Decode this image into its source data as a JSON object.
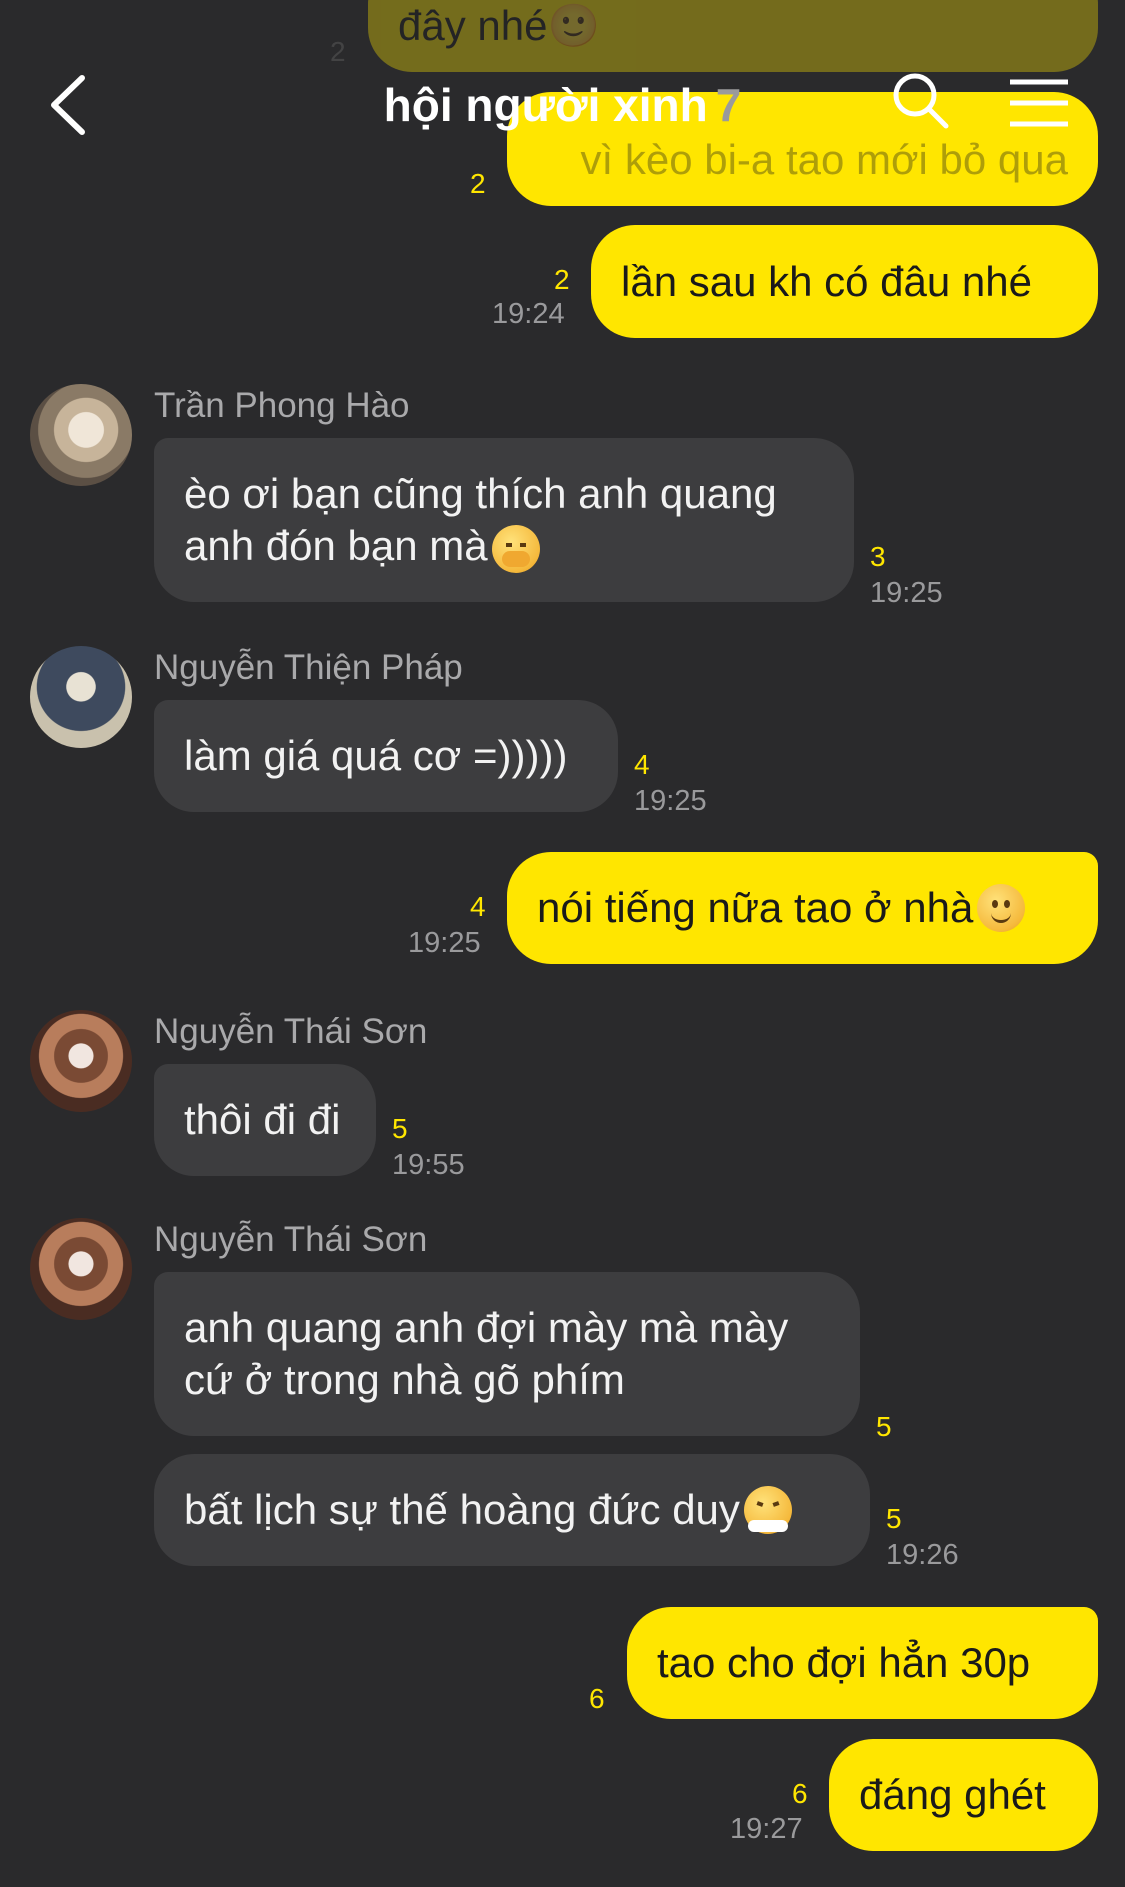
{
  "header": {
    "title": "hội người xinh",
    "member_count": "7"
  },
  "colors": {
    "background": "#2a2a2c",
    "my_bubble": "#ffe600",
    "their_bubble": "#3d3d3f",
    "unread_count": "#ffe600"
  },
  "messages": {
    "m0": {
      "text": "đây nhé🙂",
      "unread": "2"
    },
    "m1": {
      "text": "vì kèo bi-a tao mới bỏ qua",
      "unread": "2"
    },
    "m2": {
      "text": "lần sau kh có đâu nhé",
      "unread": "2",
      "time": "19:24"
    },
    "m3": {
      "sender": "Trần Phong Hào",
      "line1": "èo ơi bạn cũng thích anh quang",
      "line2": "anh đón bạn mà",
      "emoji": "hand-over-mouth-emoji",
      "unread": "3",
      "time": "19:25"
    },
    "m4": {
      "sender": "Nguyễn Thiện Pháp",
      "text": "làm giá quá cơ =)))))",
      "unread": "4",
      "time": "19:25"
    },
    "m5": {
      "text": "nói tiếng nữa tao ở nhà",
      "emoji": "slight-smile-emoji",
      "unread": "4",
      "time": "19:25"
    },
    "m6": {
      "sender": "Nguyễn Thái Sơn",
      "text": "thôi đi đi",
      "unread": "5",
      "time": "19:55"
    },
    "m7": {
      "sender": "Nguyễn Thái Sơn",
      "line1": "anh quang anh đợi mày mà mày",
      "line2": "cứ ở trong nhà gõ phím",
      "unread": "5"
    },
    "m8": {
      "text": "bất lịch sự thế hoàng đức duy",
      "emoji": "steam-from-nose-emoji",
      "unread": "5",
      "time": "19:26"
    },
    "m9": {
      "text": "tao cho đợi hẳn 30p",
      "unread": "6"
    },
    "m10": {
      "text": "đáng ghét",
      "unread": "6",
      "time": "19:27"
    }
  }
}
